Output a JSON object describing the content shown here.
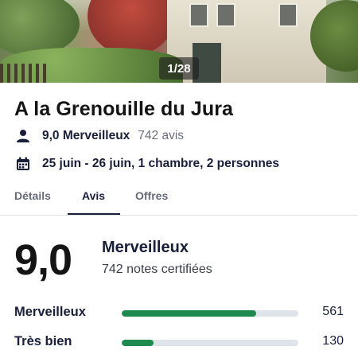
{
  "gallery": {
    "counter": "1/28"
  },
  "hotel": {
    "name": "A la Grenouille du Jura",
    "rating_summary": "9,0 Merveilleux",
    "review_count": "742 avis",
    "stay_details": "25 juin - 26 juin, 1 chambre, 2 personnes"
  },
  "tabs": [
    {
      "label": "Détails",
      "active": false
    },
    {
      "label": "Avis",
      "active": true
    },
    {
      "label": "Offres",
      "active": false
    }
  ],
  "reviews": {
    "score": "9,0",
    "score_label": "Merveilleux",
    "verified_count": "742 notes certifiées",
    "distribution": [
      {
        "label": "Merveilleux",
        "count": "561",
        "fraction": 0.76
      },
      {
        "label": "Très bien",
        "count": "130",
        "fraction": 0.18
      }
    ]
  },
  "colors": {
    "bar_fill": "#1e8a4f",
    "bar_track": "#dfe3ea",
    "text_primary": "#191e3b"
  },
  "icons": {
    "rating": "person-icon",
    "dates": "calendar-icon"
  }
}
